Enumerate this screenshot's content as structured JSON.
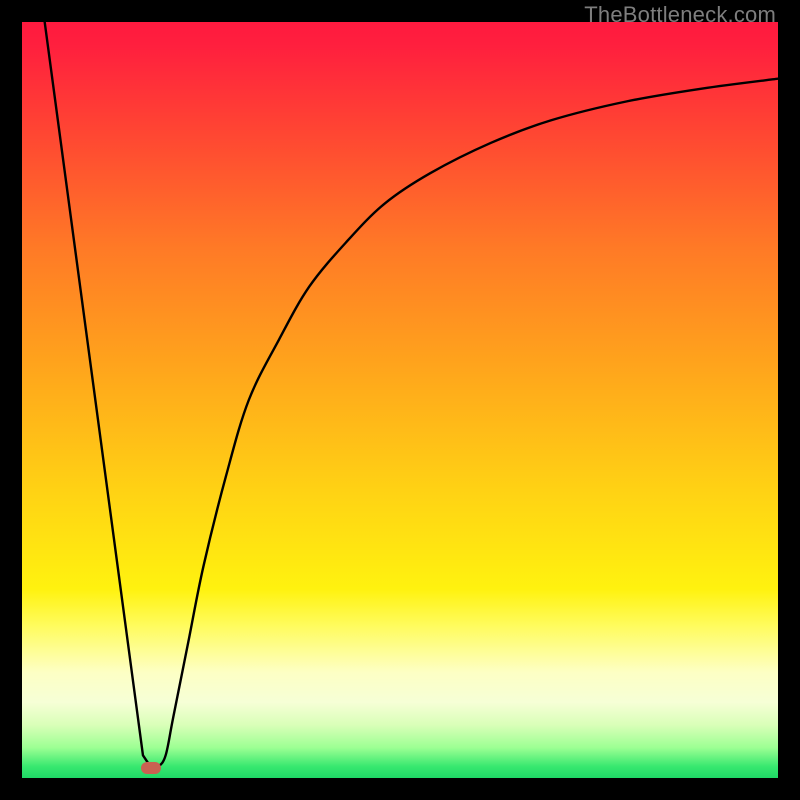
{
  "watermark": "TheBottleneck.com",
  "chart_data": {
    "type": "line",
    "title": "",
    "xlabel": "",
    "ylabel": "",
    "xlim": [
      0,
      100
    ],
    "ylim": [
      0,
      100
    ],
    "grid": false,
    "legend": false,
    "gradient": {
      "stops": [
        {
          "offset": 0.0,
          "color": "#ff1a3f"
        },
        {
          "offset": 0.03,
          "color": "#ff1f3e"
        },
        {
          "offset": 0.15,
          "color": "#ff4732"
        },
        {
          "offset": 0.3,
          "color": "#ff7a26"
        },
        {
          "offset": 0.45,
          "color": "#ffa31c"
        },
        {
          "offset": 0.62,
          "color": "#ffd214"
        },
        {
          "offset": 0.75,
          "color": "#fff20f"
        },
        {
          "offset": 0.8,
          "color": "#fffc60"
        },
        {
          "offset": 0.86,
          "color": "#fdffc4"
        },
        {
          "offset": 0.9,
          "color": "#f6ffd6"
        },
        {
          "offset": 0.93,
          "color": "#d9ffb8"
        },
        {
          "offset": 0.96,
          "color": "#9cff93"
        },
        {
          "offset": 0.985,
          "color": "#37e86f"
        },
        {
          "offset": 1.0,
          "color": "#1fd866"
        }
      ]
    },
    "series": [
      {
        "name": "curve",
        "color": "#000000",
        "x": [
          3,
          16,
          17,
          18,
          19,
          20,
          22,
          24,
          27,
          30,
          34,
          38,
          43,
          48,
          54,
          62,
          70,
          80,
          90,
          100
        ],
        "y": [
          100,
          3,
          1.5,
          1.5,
          3,
          8,
          18,
          28,
          40,
          50,
          58,
          65,
          71,
          76,
          80,
          84,
          87,
          89.5,
          91.2,
          92.5
        ]
      }
    ],
    "marker": {
      "x": 17,
      "y": 1.3,
      "color": "#c96251"
    }
  }
}
